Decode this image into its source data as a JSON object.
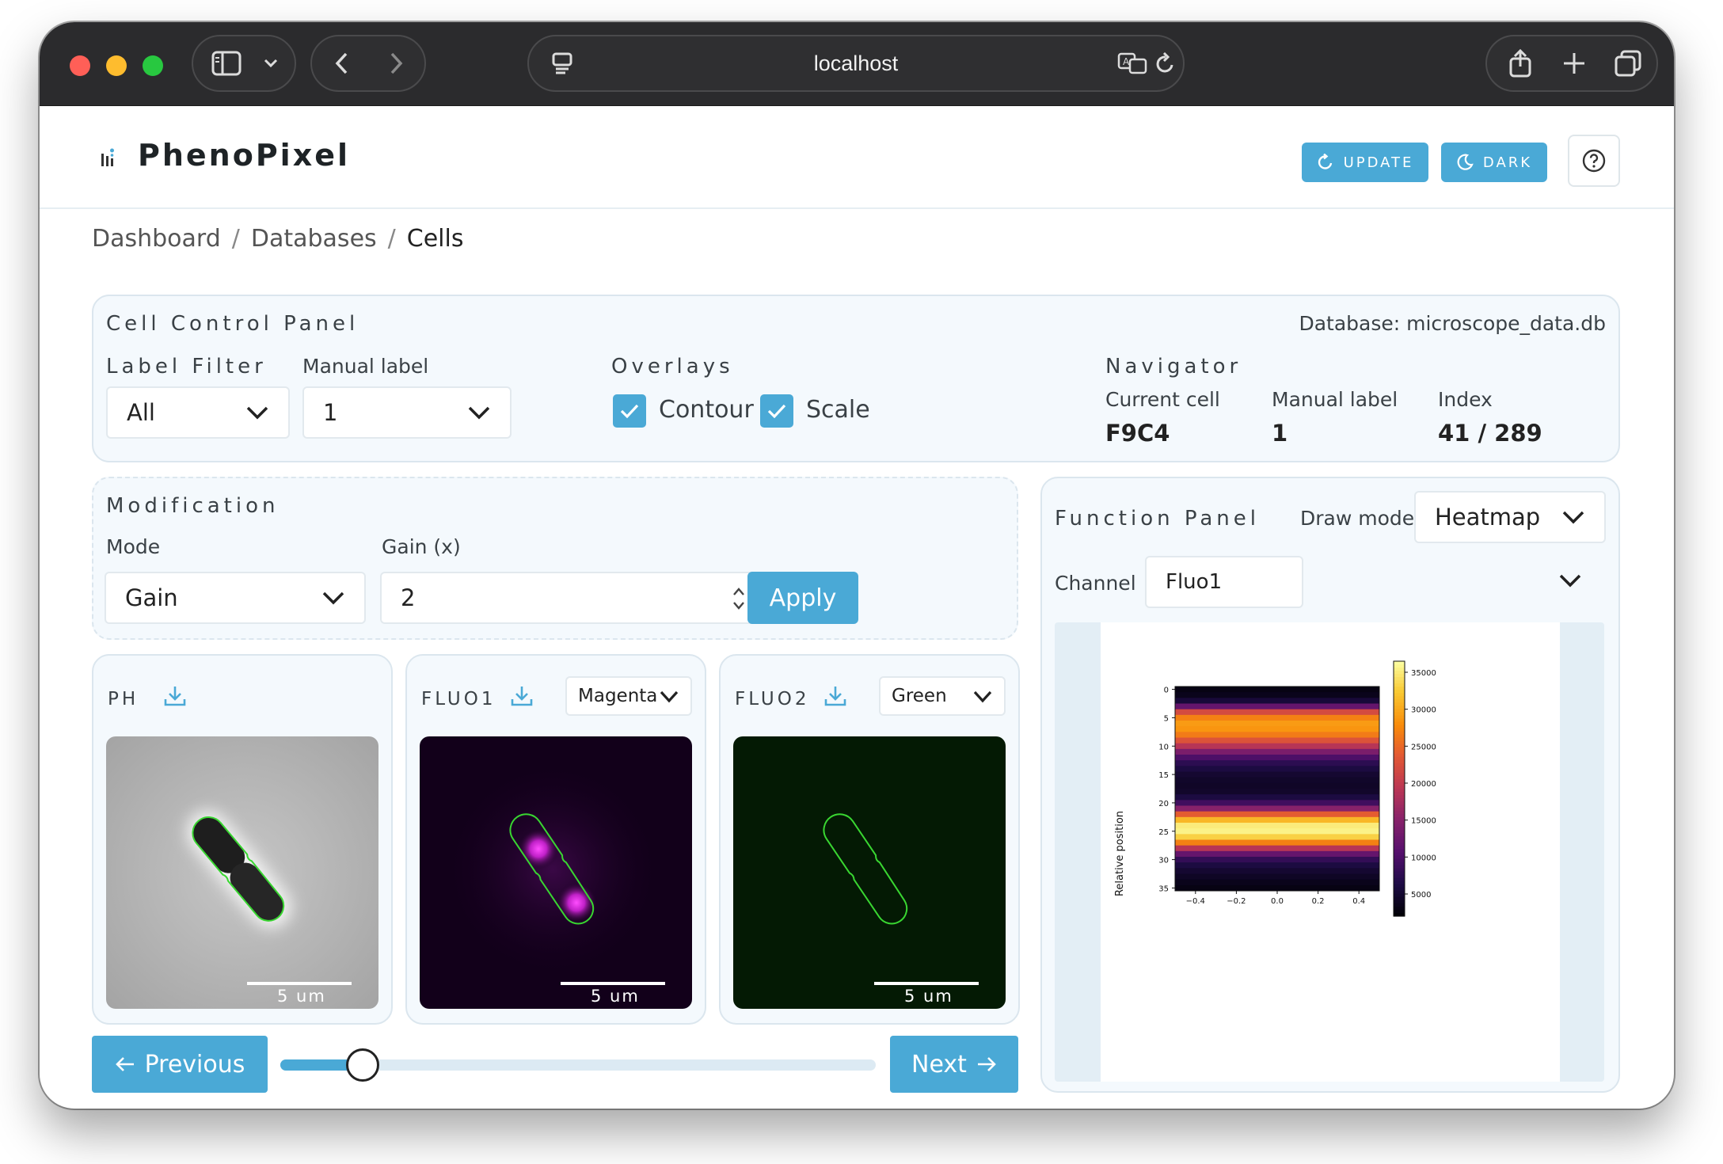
{
  "browser": {
    "url": "localhost"
  },
  "header": {
    "app_title": "PhenoPixel",
    "update_label": "UPDATE",
    "dark_label": "DARK"
  },
  "breadcrumb": {
    "items": [
      "Dashboard",
      "Databases",
      "Cells"
    ]
  },
  "control_panel": {
    "title": "Cell Control Panel",
    "database": "Database: microscope_data.db",
    "label_filter": {
      "label": "Label Filter",
      "value": "All"
    },
    "manual_label": {
      "label": "Manual label",
      "value": "1"
    },
    "overlays": {
      "title": "Overlays",
      "contour": {
        "label": "Contour",
        "checked": true
      },
      "scale": {
        "label": "Scale",
        "checked": true
      }
    },
    "navigator": {
      "title": "Navigator",
      "current_cell_label": "Current cell",
      "current_cell_value": "F9C4",
      "manual_label_label": "Manual label",
      "manual_label_value": "1",
      "index_label": "Index",
      "index_value": "41 / 289"
    }
  },
  "modification": {
    "title": "Modification",
    "mode_label": "Mode",
    "mode_value": "Gain",
    "gain_label": "Gain (x)",
    "gain_value": "2",
    "apply_label": "Apply"
  },
  "images": {
    "ph": {
      "title": "PH",
      "scale_text": "5 um"
    },
    "fluo1": {
      "title": "FLUO1",
      "color_value": "Magenta",
      "scale_text": "5 um"
    },
    "fluo2": {
      "title": "FLUO2",
      "color_value": "Green",
      "scale_text": "5 um"
    }
  },
  "navigation": {
    "previous_label": "Previous",
    "next_label": "Next",
    "slider_fraction": 0.1387
  },
  "function_panel": {
    "title": "Function Panel",
    "draw_mode_label": "Draw mode",
    "draw_mode_value": "Heatmap",
    "channel_label": "Channel",
    "channel_value": "Fluo1"
  },
  "chart_data": {
    "type": "heatmap",
    "title": "",
    "xlabel": "",
    "ylabel": "Relative position",
    "x_ticks": [
      "−0.4",
      "−0.2",
      "0.0",
      "0.2",
      "0.4"
    ],
    "x_tick_values": [
      -0.4,
      -0.2,
      0.0,
      0.2,
      0.4
    ],
    "xlim": [
      -0.5,
      0.5
    ],
    "y_ticks": [
      "0",
      "5",
      "10",
      "15",
      "20",
      "25",
      "30",
      "35"
    ],
    "y_tick_values": [
      0,
      5,
      10,
      15,
      20,
      25,
      30,
      35
    ],
    "ylim": [
      -0.5,
      35.5
    ],
    "colorbar_ticks": [
      "35000",
      "30000",
      "25000",
      "20000",
      "15000",
      "10000",
      "5000"
    ],
    "colorbar_tick_values": [
      35000,
      30000,
      25000,
      20000,
      15000,
      10000,
      5000
    ],
    "colorbar_range": [
      2000,
      36500
    ],
    "colormap": "inferno",
    "row_values": [
      3000,
      3500,
      5500,
      12000,
      22000,
      27000,
      29000,
      28500,
      26500,
      23000,
      19000,
      14000,
      10000,
      7500,
      6000,
      5000,
      4500,
      4300,
      4600,
      6000,
      9000,
      15000,
      24000,
      31000,
      35000,
      35500,
      33000,
      27000,
      19000,
      12000,
      8000,
      6000,
      5000,
      4200,
      3500,
      3000
    ]
  }
}
